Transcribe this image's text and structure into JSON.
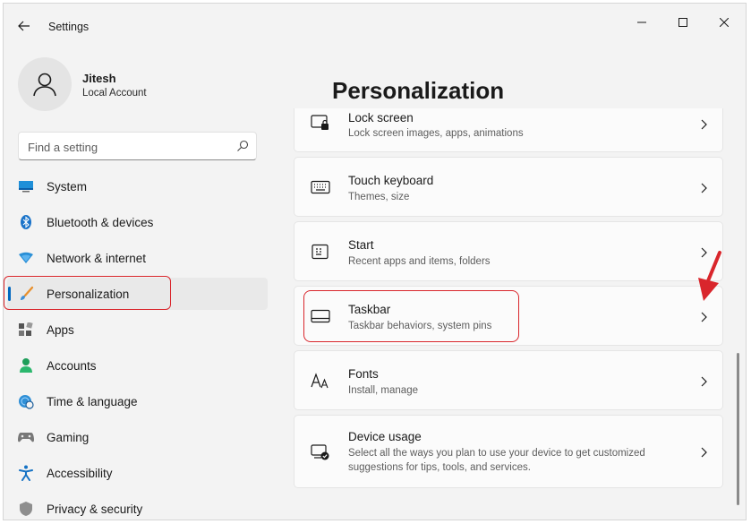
{
  "window": {
    "title": "Settings"
  },
  "user": {
    "name": "Jitesh",
    "account_type": "Local Account"
  },
  "search": {
    "placeholder": "Find a setting"
  },
  "nav": {
    "items": [
      {
        "label": "System",
        "icon": "monitor-icon"
      },
      {
        "label": "Bluetooth & devices",
        "icon": "bluetooth-icon"
      },
      {
        "label": "Network & internet",
        "icon": "wifi-icon"
      },
      {
        "label": "Personalization",
        "icon": "brush-icon",
        "active": true
      },
      {
        "label": "Apps",
        "icon": "apps-icon"
      },
      {
        "label": "Accounts",
        "icon": "person-icon"
      },
      {
        "label": "Time & language",
        "icon": "globe-clock-icon"
      },
      {
        "label": "Gaming",
        "icon": "gamepad-icon"
      },
      {
        "label": "Accessibility",
        "icon": "accessibility-icon"
      },
      {
        "label": "Privacy & security",
        "icon": "shield-icon"
      }
    ]
  },
  "main": {
    "title": "Personalization",
    "cards": [
      {
        "title": "Lock screen",
        "subtitle": "Lock screen images, apps, animations",
        "icon": "lock-screen-icon"
      },
      {
        "title": "Touch keyboard",
        "subtitle": "Themes, size",
        "icon": "keyboard-icon"
      },
      {
        "title": "Start",
        "subtitle": "Recent apps and items, folders",
        "icon": "start-icon"
      },
      {
        "title": "Taskbar",
        "subtitle": "Taskbar behaviors, system pins",
        "icon": "taskbar-icon"
      },
      {
        "title": "Fonts",
        "subtitle": "Install, manage",
        "icon": "fonts-icon"
      },
      {
        "title": "Device usage",
        "subtitle": "Select all the ways you plan to use your device to get customized suggestions for tips, tools, and services.",
        "icon": "device-usage-icon"
      }
    ]
  },
  "colors": {
    "accent": "#0067c0",
    "annotation": "#d9262c"
  }
}
